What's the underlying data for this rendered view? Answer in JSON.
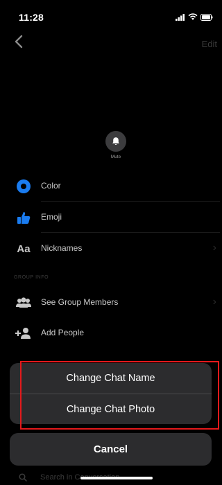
{
  "status_bar": {
    "time": "11:28"
  },
  "nav": {
    "edit_label": "Edit"
  },
  "mute": {
    "label": "Mute"
  },
  "settings": {
    "items": [
      {
        "label": "Color"
      },
      {
        "label": "Emoji"
      },
      {
        "label": "Nicknames",
        "icon_text": "Aa"
      }
    ]
  },
  "group_info": {
    "header": "GROUP INFO",
    "items": [
      {
        "label": "See Group Members"
      },
      {
        "label": "Add People"
      }
    ]
  },
  "action_sheet": {
    "change_name_label": "Change Chat Name",
    "change_photo_label": "Change Chat Photo",
    "cancel_label": "Cancel"
  },
  "search": {
    "placeholder": "Search in Conversation"
  },
  "colors": {
    "accent_blue": "#1a7cf0",
    "highlight_red": "#e5191b",
    "sheet_bg": "#2c2c2e"
  }
}
